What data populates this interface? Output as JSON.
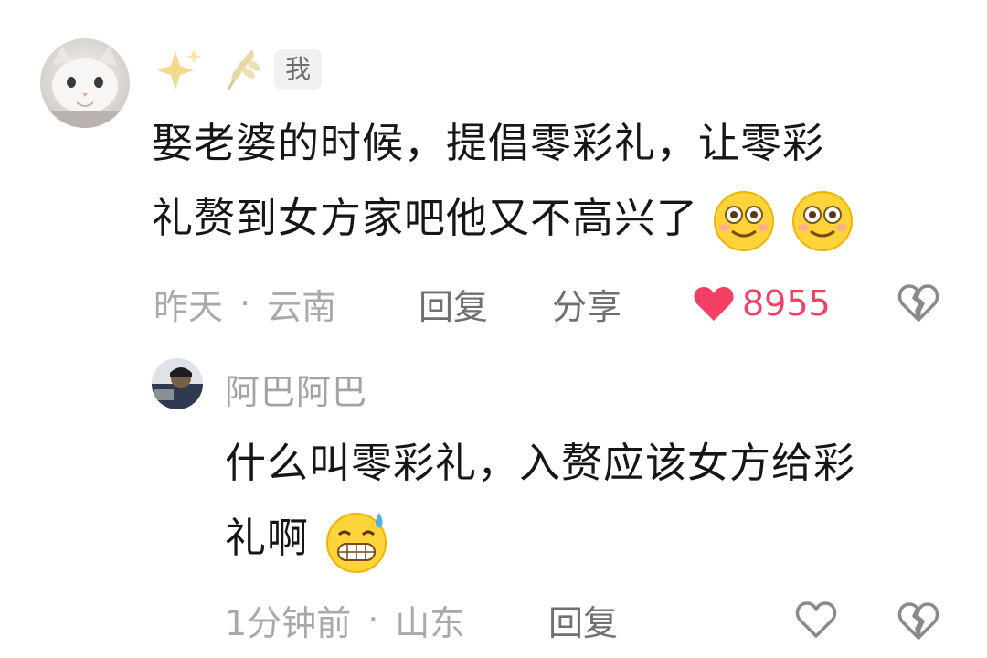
{
  "comment": {
    "badge": "我",
    "text_line1": "娶老婆的时候，提倡零彩礼，让零彩",
    "text_line2": "礼赘到女方家吧他又不高兴了",
    "time": "昨天",
    "sep": "·",
    "location": "云南",
    "reply_label": "回复",
    "share_label": "分享",
    "like_count": "8955",
    "liked": true,
    "icons": [
      "sparkles-icon",
      "wheat-icon",
      "smile-emoji",
      "heart-filled-icon",
      "broken-heart-icon"
    ],
    "colors": {
      "like": "#f23f63",
      "meta": "#a9a9ac"
    }
  },
  "reply": {
    "username": "阿巴阿巴",
    "text_line1": "什么叫零彩礼，入赘应该女方给彩",
    "text_line2": "礼啊",
    "time": "1分钟前",
    "sep": "·",
    "location": "山东",
    "reply_label": "回复",
    "icons": [
      "sweat-grin-emoji",
      "heart-outline-icon",
      "broken-heart-icon"
    ]
  }
}
